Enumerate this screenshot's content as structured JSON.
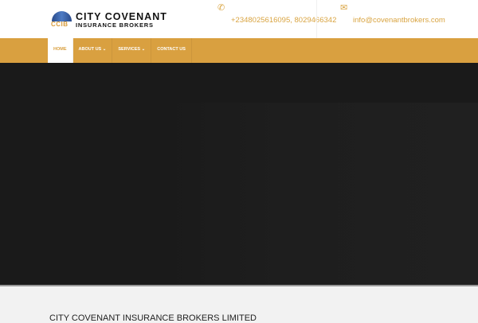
{
  "header": {
    "logo": {
      "line1": "CITY COVENANT",
      "line2": "INSURANCE BROKERS",
      "mark": "CCIB"
    },
    "phone": {
      "icon": "phone-icon",
      "text": "+2348025616095, 8029466342"
    },
    "email": {
      "icon": "envelope-icon",
      "text": "info@covenantbrokers.com"
    }
  },
  "nav": {
    "items": [
      {
        "label": "HOME",
        "active": true
      },
      {
        "label": "ABOUT US ⌄"
      },
      {
        "label": "SERVICES ⌄"
      },
      {
        "label": "CONTACT US"
      }
    ]
  },
  "main": {
    "title": "CITY COVENANT INSURANCE BROKERS LIMITED"
  },
  "colors": {
    "accent": "#d9a040",
    "hero": "#1a1a1a"
  }
}
